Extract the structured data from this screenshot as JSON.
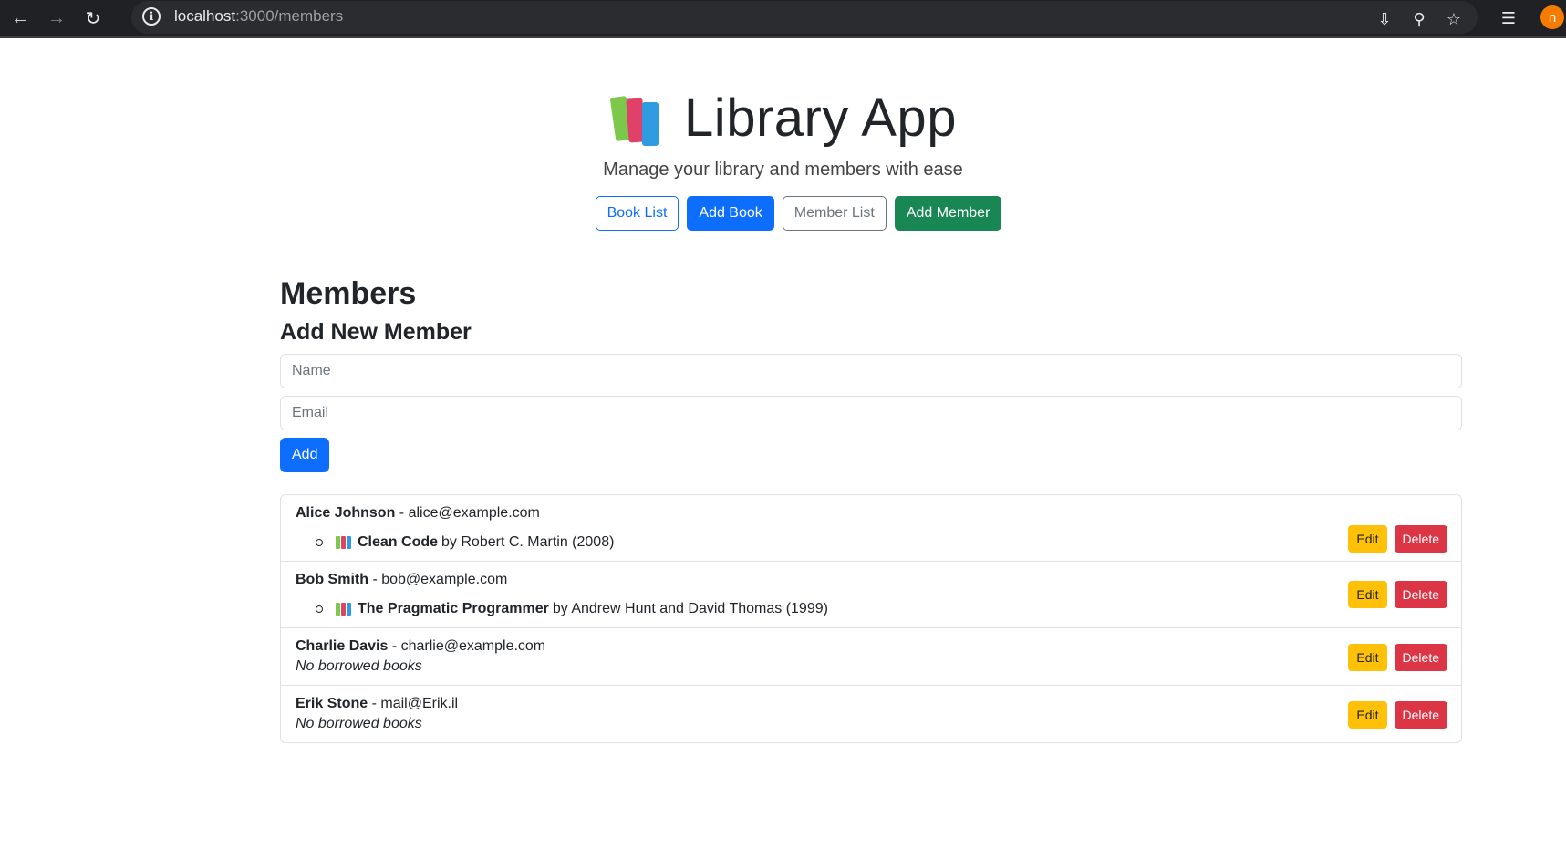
{
  "browser": {
    "url_host": "localhost",
    "url_path": ":3000/members"
  },
  "header": {
    "title": "Library App",
    "subtitle": "Manage your library and members with ease",
    "nav": {
      "book_list": "Book List",
      "add_book": "Add Book",
      "member_list": "Member List",
      "add_member": "Add Member"
    }
  },
  "main": {
    "heading": "Members",
    "form": {
      "heading": "Add New Member",
      "name_placeholder": "Name",
      "email_placeholder": "Email",
      "add_label": "Add"
    },
    "members": [
      {
        "name": "Alice Johnson",
        "email": " - alice@example.com",
        "book_title": "Clean Code",
        "book_by": "by Robert C. Martin (2008)"
      },
      {
        "name": "Bob Smith",
        "email": " - bob@example.com",
        "book_title": "The Pragmatic Programmer",
        "book_by": "by Andrew Hunt and David Thomas (1999)"
      },
      {
        "name": "Charlie Davis",
        "email": " - charlie@example.com",
        "no_books": "No borrowed books"
      },
      {
        "name": "Erik Stone",
        "email": " - mail@Erik.il",
        "no_books": "No borrowed books"
      }
    ],
    "edit_label": "Edit",
    "delete_label": "Delete"
  },
  "colors": {
    "primary": "#0d6efd",
    "success": "#198754",
    "warning": "#ffc107",
    "danger": "#dc3545",
    "secondary": "#6c757d"
  }
}
